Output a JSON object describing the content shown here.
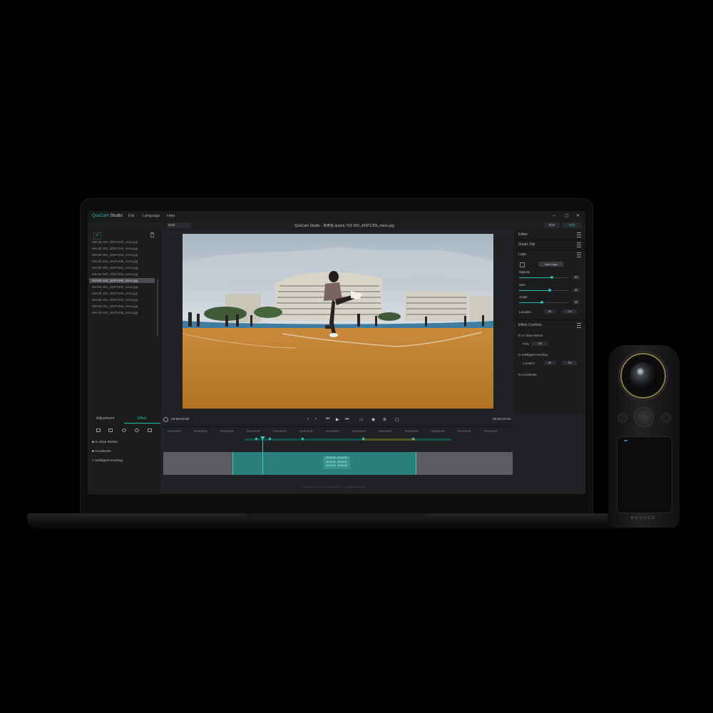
{
  "app": {
    "logo_brand": "QooCam",
    "logo_suffix": " Studio",
    "menu": [
      "File",
      "Language",
      "Help"
    ],
    "window_controls": [
      "–",
      "▢",
      "✕"
    ],
    "document_title": "QooCam Studio - 未命名.qcproj / KD 360_420P1265_mono.jpg",
    "view_select": "Both",
    "page_count": "0/10",
    "export_label": "Edit"
  },
  "files": [
    "IMAGE 360_420P1265_mono.jpg",
    "IMAGE 360_420P1265_mono.jpg",
    "IMAGE 360_420P1265_mono.jpg",
    "IMAGE 360_420P1265_mono.jpg",
    "IMAGE 360_420P1265_mono.jpg",
    "IMAGE 360_420P1265_mono.jpg",
    "IMAGE 360_420P1265_mono.jpg",
    "IMAGE 360_420P1265_mono.jpg",
    "IMAGE 360_420P1265_mono.jpg",
    "IMAGE 360_420P1265_mono.jpg",
    "IMAGE 360_420P1265_mono.jpg",
    "IMAGE 360_420P1265_mono.jpg"
  ],
  "selected_file_index": 6,
  "right_panel": {
    "editor": "Editor",
    "smart_clip": "Smart Clip",
    "logo": "Logo",
    "add_logo": "Add Logo",
    "opacity": {
      "label": "Opacity",
      "value": "80",
      "fraction": 0.65
    },
    "size": {
      "label": "Size",
      "value": "80",
      "fraction": 0.62
    },
    "angle": {
      "label": "Angle",
      "value": "30",
      "fraction": 0.45
    },
    "location": {
      "label": "Location",
      "x": "95",
      "y": "172"
    },
    "effect_controls": "Effect Controls",
    "ai_slow_motion": "fx  AI Slow Motion",
    "fps_label": "FPS",
    "fps_value": "Off",
    "intelligent_tracking": "fx  Intelligent tracking",
    "tracking_location": {
      "label": "Location",
      "x": "95",
      "y": "112"
    },
    "accelerate": "fx  Accelerate"
  },
  "bottom": {
    "tabs": [
      "Adjustment",
      "Effect"
    ],
    "active_tab": 1,
    "effects": [
      "AI Slow Motion",
      "Accelerate",
      "Intelligent tracking"
    ],
    "time_start": "00:00:00:00",
    "time_end": "00:00:00:00",
    "ruler": [
      "00:00:00:00",
      "00:00:00:00",
      "00:00:00:00",
      "00:00:00:00",
      "00:00:00:00",
      "00:00:00:00",
      "00:00:00:00",
      "00:00:00:00",
      "00:00:00:00",
      "00:00:00:00",
      "00:00:00:00",
      "00:00:00:00",
      "00:00:00:00"
    ],
    "clip_lines": [
      "00:00:00 - 00:00:00",
      "00:00:00 - 00:00:00",
      "00:00:00 - 00:00:00"
    ],
    "footer": "Accelerate: 2X · AI Slow Motion: 2X · Intelligent tracking"
  },
  "camera": {
    "brand": "QOOCAM"
  },
  "colors": {
    "accent": "#2fb6ae",
    "background": "#1d1e20",
    "clip": "#2b7f7b"
  }
}
